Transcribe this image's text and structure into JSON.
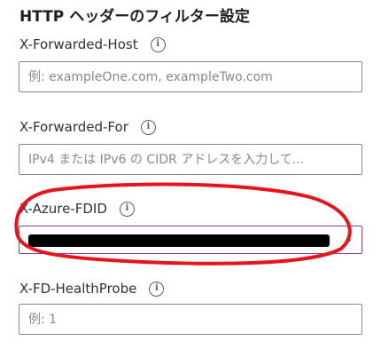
{
  "section": {
    "title": "HTTP ヘッダーのフィルター設定"
  },
  "fields": [
    {
      "label": "X-Forwarded-Host",
      "info_icon": "info-icon",
      "placeholder": "例: exampleOne.com, exampleTwo.com",
      "value": ""
    },
    {
      "label": "X-Forwarded-For",
      "info_icon": "info-icon",
      "placeholder": "IPv4 または IPv6 の CIDR アドレスを入力して...",
      "value": ""
    },
    {
      "label": "X-Azure-FDID",
      "info_icon": "info-icon",
      "value_redacted": true,
      "dropdown_icon": "chevron-down-icon"
    },
    {
      "label": "X-FD-HealthProbe",
      "info_icon": "info-icon",
      "placeholder": "例: 1",
      "value": ""
    }
  ],
  "colors": {
    "annotation": "#e8141b",
    "focus_border": "#8a3aa6",
    "input_border": "#8a8886",
    "placeholder": "#8a8886"
  }
}
